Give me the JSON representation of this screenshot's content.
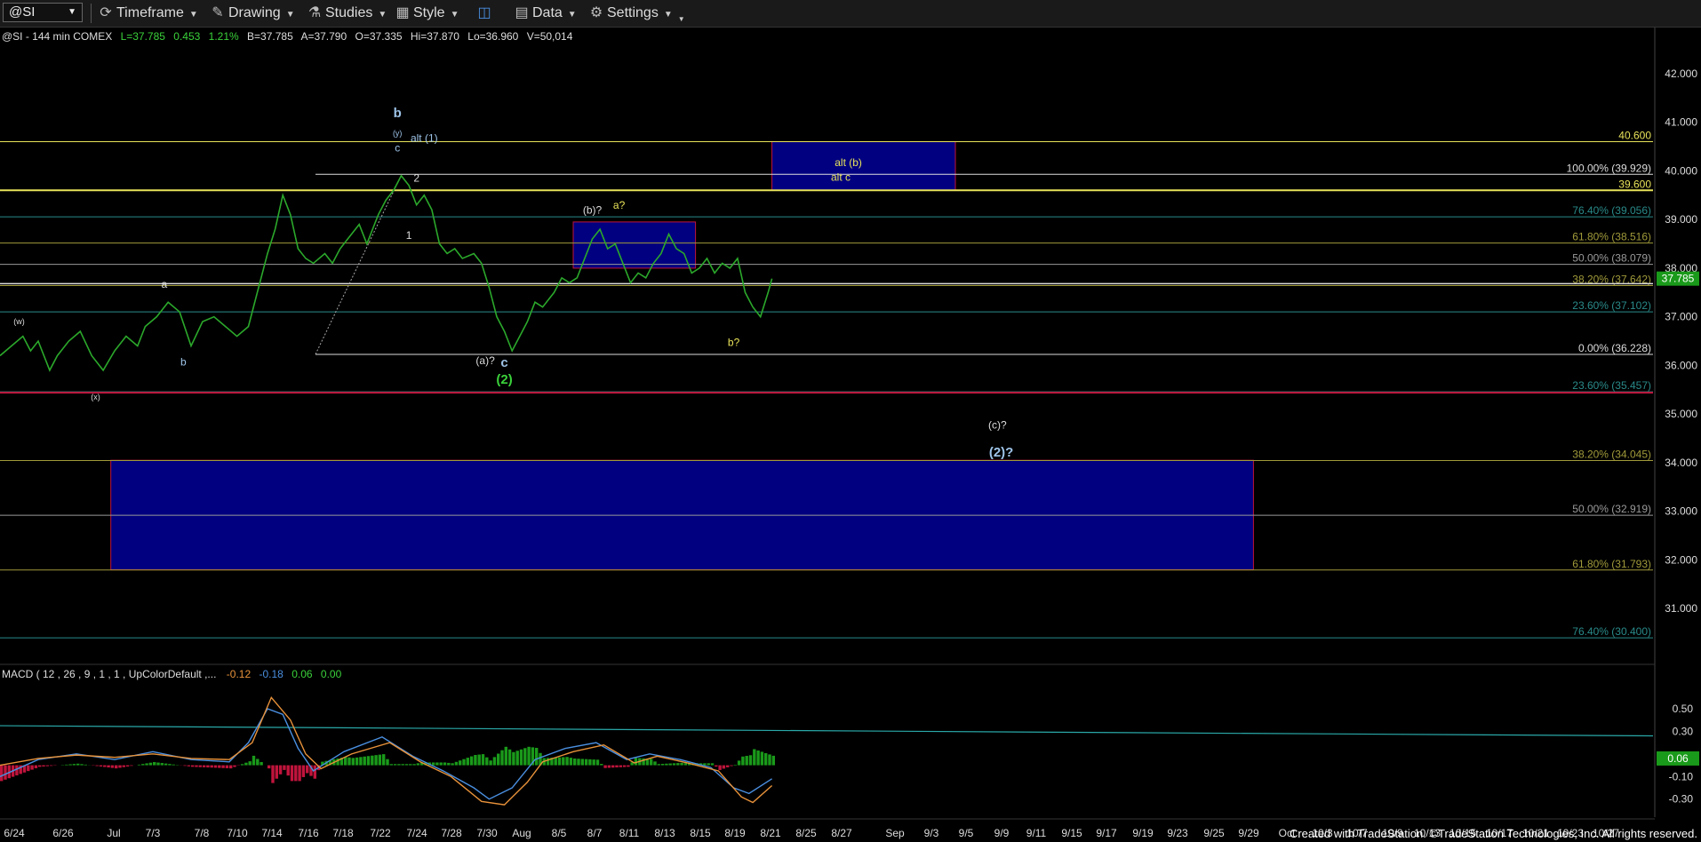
{
  "toolbar": {
    "symbol": "@SI",
    "timeframe": "Timeframe",
    "drawing": "Drawing",
    "studies": "Studies",
    "style": "Style",
    "data": "Data",
    "settings": "Settings"
  },
  "header": {
    "symbol_info": "@SI - 144 min  COMEX",
    "last": "L=37.785",
    "change": "0.453",
    "pct": "1.21%",
    "bid": "B=37.785",
    "ask": "A=37.790",
    "open": "O=37.335",
    "high": "Hi=37.870",
    "low": "Lo=36.960",
    "volume": "V=50,014"
  },
  "macd": {
    "label": "MACD ( 12 , 26 , 9 , 1 , 1 , UpColorDefault ,...",
    "v1": "-0.12",
    "v2": "-0.18",
    "v3": "0.06",
    "v4": "0.00",
    "current": "0.06"
  },
  "footer": "Created with TradeStation. ©TradeStation Technologies, Inc. All rights reserved.",
  "colors": {
    "price": "#2ba82b",
    "zone_fill": "#000080",
    "zone_border": "#c0143c",
    "yellow": "#e8e35a",
    "white": "#dddddd",
    "teal": "#2a8a8a"
  },
  "chart_data": [
    {
      "type": "line",
      "title": "",
      "ylim": [
        30.0,
        42.6
      ],
      "y_ticks": [
        "42.000",
        "41.000",
        "40.000",
        "39.000",
        "38.000",
        "37.000",
        "36.000",
        "35.000",
        "34.000",
        "33.000",
        "32.000",
        "31.000"
      ],
      "y_tick_values": [
        42,
        41,
        40,
        39,
        38,
        37,
        36,
        35,
        34,
        33,
        32,
        31
      ],
      "x_ticks": [
        "6/24",
        "6/26",
        "Jul",
        "7/3",
        "7/8",
        "7/10",
        "7/14",
        "7/16",
        "7/18",
        "7/22",
        "7/24",
        "7/28",
        "7/30",
        "Aug",
        "8/5",
        "8/7",
        "8/11",
        "8/13",
        "8/15",
        "8/19",
        "8/21",
        "8/25",
        "8/27",
        "Sep",
        "9/3",
        "9/5",
        "9/9",
        "9/11",
        "9/15",
        "9/17",
        "9/19",
        "9/23",
        "9/25",
        "9/29",
        "Oct",
        "10/3",
        "10/7",
        "10/9",
        "10/13",
        "10/15",
        "10/17",
        "10/21",
        "10/23",
        "10/27"
      ],
      "last_price": "37.785",
      "last_price_value": 37.785,
      "series": [
        {
          "values": [
            [
              0,
              36.2
            ],
            [
              3,
              36.4
            ],
            [
              6,
              36.6
            ],
            [
              8,
              36.3
            ],
            [
              10,
              36.5
            ],
            [
              13,
              35.9
            ],
            [
              15,
              36.2
            ],
            [
              18,
              36.5
            ],
            [
              21,
              36.7
            ],
            [
              24,
              36.2
            ],
            [
              27,
              35.9
            ],
            [
              30,
              36.3
            ],
            [
              33,
              36.6
            ],
            [
              36,
              36.4
            ],
            [
              38,
              36.8
            ],
            [
              41,
              37.0
            ],
            [
              44,
              37.3
            ],
            [
              47,
              37.1
            ],
            [
              50,
              36.4
            ],
            [
              53,
              36.9
            ],
            [
              56,
              37.0
            ],
            [
              59,
              36.8
            ],
            [
              62,
              36.6
            ],
            [
              65,
              36.8
            ],
            [
              67,
              37.4
            ],
            [
              70,
              38.3
            ],
            [
              72,
              38.8
            ],
            [
              74,
              39.5
            ],
            [
              76,
              39.1
            ],
            [
              78,
              38.4
            ],
            [
              80,
              38.2
            ],
            [
              82,
              38.1
            ],
            [
              85,
              38.3
            ],
            [
              87,
              38.1
            ],
            [
              89,
              38.4
            ],
            [
              91,
              38.6
            ],
            [
              94,
              38.9
            ],
            [
              96,
              38.5
            ],
            [
              99,
              39.1
            ],
            [
              101,
              39.4
            ],
            [
              103,
              39.6
            ],
            [
              105,
              39.9
            ],
            [
              107,
              39.7
            ],
            [
              109,
              39.3
            ],
            [
              111,
              39.5
            ],
            [
              113,
              39.2
            ],
            [
              115,
              38.5
            ],
            [
              117,
              38.3
            ],
            [
              119,
              38.4
            ],
            [
              121,
              38.2
            ],
            [
              124,
              38.3
            ],
            [
              126,
              38.1
            ],
            [
              128,
              37.6
            ],
            [
              130,
              37.0
            ],
            [
              132,
              36.7
            ],
            [
              134,
              36.3
            ],
            [
              136,
              36.6
            ],
            [
              138,
              36.9
            ],
            [
              140,
              37.3
            ],
            [
              142,
              37.2
            ],
            [
              145,
              37.5
            ],
            [
              147,
              37.8
            ],
            [
              149,
              37.7
            ],
            [
              151,
              37.8
            ],
            [
              153,
              38.2
            ],
            [
              155,
              38.6
            ],
            [
              157,
              38.8
            ],
            [
              159,
              38.4
            ],
            [
              161,
              38.5
            ],
            [
              163,
              38.1
            ],
            [
              165,
              37.7
            ],
            [
              167,
              37.9
            ],
            [
              169,
              37.8
            ],
            [
              171,
              38.1
            ],
            [
              173,
              38.3
            ],
            [
              175,
              38.7
            ],
            [
              177,
              38.4
            ],
            [
              179,
              38.3
            ],
            [
              181,
              37.9
            ],
            [
              183,
              38.0
            ],
            [
              185,
              38.2
            ],
            [
              187,
              37.9
            ],
            [
              189,
              38.1
            ],
            [
              191,
              38.0
            ],
            [
              193,
              38.2
            ],
            [
              195,
              37.5
            ],
            [
              197,
              37.2
            ],
            [
              199,
              37.0
            ],
            [
              201,
              37.5
            ],
            [
              202,
              37.785
            ]
          ]
        }
      ],
      "horizontal_levels": [
        {
          "label": "40.600",
          "value": 40.6,
          "color": "#e8e35a"
        },
        {
          "label": "100.00% (39.929)",
          "value": 39.929,
          "color": "#dddddd"
        },
        {
          "label": "39.600",
          "value": 39.6,
          "color": "#e8e35a"
        },
        {
          "label": "76.40% (39.056)",
          "value": 39.056,
          "color": "#2a8a8a"
        },
        {
          "label": "61.80% (38.516)",
          "value": 38.516,
          "color": "#a09a3a"
        },
        {
          "label": "50.00% (38.079)",
          "value": 38.079,
          "color": "#999999"
        },
        {
          "label": "38.20% (37.642)",
          "value": 37.642,
          "color": "#a09a3a"
        },
        {
          "label": "23.60% (37.102)",
          "value": 37.102,
          "color": "#2a8a8a"
        },
        {
          "label": "0.00% (36.228)",
          "value": 36.228,
          "color": "#dddddd"
        },
        {
          "label": "23.60% (35.457)",
          "value": 35.457,
          "color": "#2a8a8a"
        },
        {
          "label": "38.20% (34.045)",
          "value": 34.045,
          "color": "#a09a3a"
        },
        {
          "label": "50.00% (32.919)",
          "value": 32.919,
          "color": "#999999"
        },
        {
          "label": "61.80% (31.793)",
          "value": 31.793,
          "color": "#a09a3a"
        },
        {
          "label": "76.40% (30.400)",
          "value": 30.4,
          "color": "#2a8a8a"
        }
      ],
      "annotations": [
        {
          "text": "b",
          "x": 104,
          "y": 41.1,
          "color": "#9ec4e8",
          "bold": true
        },
        {
          "text": "(y)",
          "x": 104,
          "y": 40.72,
          "color": "#9ec4e8",
          "small": true
        },
        {
          "text": "c",
          "x": 104,
          "y": 40.4,
          "color": "#9ec4e8"
        },
        {
          "text": "alt (1)",
          "x": 111,
          "y": 40.6,
          "color": "#9ec4e8"
        },
        {
          "text": "2",
          "x": 109,
          "y": 39.78,
          "color": "#dddddd"
        },
        {
          "text": "1",
          "x": 107,
          "y": 38.6,
          "color": "#dddddd"
        },
        {
          "text": "(w)",
          "x": 5,
          "y": 36.85,
          "color": "#dddddd",
          "small": true
        },
        {
          "text": "a",
          "x": 43,
          "y": 37.6,
          "color": "#dddddd"
        },
        {
          "text": "b",
          "x": 48,
          "y": 36.0,
          "color": "#9ec4e8"
        },
        {
          "text": "(x)",
          "x": 25,
          "y": 35.3,
          "color": "#dddddd",
          "small": true
        },
        {
          "text": "(a)?",
          "x": 127,
          "y": 36.03,
          "color": "#dddddd"
        },
        {
          "text": "c",
          "x": 132,
          "y": 35.97,
          "color": "#9ec4e8",
          "bold": true
        },
        {
          "text": "(2)",
          "x": 132,
          "y": 35.62,
          "color": "#3ad13a",
          "bold": true
        },
        {
          "text": "(b)?",
          "x": 155,
          "y": 39.12,
          "color": "#dddddd"
        },
        {
          "text": "a?",
          "x": 162,
          "y": 39.22,
          "color": "#e8e35a"
        },
        {
          "text": "b?",
          "x": 192,
          "y": 36.4,
          "color": "#e8e35a"
        },
        {
          "text": "alt (b)",
          "x": 222,
          "y": 40.1,
          "color": "#e8e35a"
        },
        {
          "text": "alt c",
          "x": 220,
          "y": 39.8,
          "color": "#e8e35a"
        },
        {
          "text": "(c)?",
          "x": 261,
          "y": 34.7,
          "color": "#dddddd"
        },
        {
          "text": "(2)?",
          "x": 262,
          "y": 34.13,
          "color": "#9ec4e8",
          "bold": true
        }
      ],
      "zones": [
        {
          "x0": 202,
          "x1": 250,
          "y0": 39.6,
          "y1": 40.6
        },
        {
          "x0": 150,
          "x1": 182,
          "y0": 38.0,
          "y1": 38.95
        },
        {
          "x0": 29,
          "x1": 328,
          "y0": 31.8,
          "y1": 34.05
        }
      ]
    },
    {
      "type": "line",
      "title": "",
      "ylim": [
        -0.42,
        0.72
      ],
      "y_ticks": [
        "0.50",
        "0.30",
        "-0.10",
        "-0.30"
      ],
      "y_tick_values": [
        0.5,
        0.3,
        -0.1,
        -0.3
      ],
      "series": [
        {
          "values": [
            [
              0,
              -0.1
            ],
            [
              10,
              0.05
            ],
            [
              20,
              0.1
            ],
            [
              30,
              0.05
            ],
            [
              40,
              0.12
            ],
            [
              50,
              0.05
            ],
            [
              60,
              0.03
            ],
            [
              65,
              0.2
            ],
            [
              70,
              0.5
            ],
            [
              74,
              0.45
            ],
            [
              78,
              0.15
            ],
            [
              82,
              -0.05
            ],
            [
              90,
              0.12
            ],
            [
              100,
              0.25
            ],
            [
              108,
              0.08
            ],
            [
              116,
              -0.05
            ],
            [
              124,
              -0.2
            ],
            [
              128,
              -0.3
            ],
            [
              134,
              -0.2
            ],
            [
              140,
              0.05
            ],
            [
              148,
              0.15
            ],
            [
              156,
              0.2
            ],
            [
              164,
              0.05
            ],
            [
              170,
              0.1
            ],
            [
              178,
              0.05
            ],
            [
              186,
              -0.02
            ],
            [
              192,
              -0.2
            ],
            [
              196,
              -0.25
            ],
            [
              202,
              -0.12
            ]
          ]
        },
        {
          "values": [
            [
              0,
              0.0
            ],
            [
              10,
              0.06
            ],
            [
              20,
              0.09
            ],
            [
              30,
              0.07
            ],
            [
              40,
              0.1
            ],
            [
              50,
              0.06
            ],
            [
              60,
              0.05
            ],
            [
              66,
              0.2
            ],
            [
              71,
              0.6
            ],
            [
              76,
              0.4
            ],
            [
              80,
              0.1
            ],
            [
              84,
              -0.03
            ],
            [
              92,
              0.1
            ],
            [
              102,
              0.2
            ],
            [
              110,
              0.03
            ],
            [
              118,
              -0.1
            ],
            [
              126,
              -0.32
            ],
            [
              132,
              -0.35
            ],
            [
              138,
              -0.15
            ],
            [
              142,
              0.03
            ],
            [
              150,
              0.12
            ],
            [
              158,
              0.18
            ],
            [
              166,
              0.02
            ],
            [
              172,
              0.08
            ],
            [
              180,
              0.02
            ],
            [
              188,
              -0.05
            ],
            [
              194,
              -0.28
            ],
            [
              197,
              -0.33
            ],
            [
              202,
              -0.18
            ]
          ]
        },
        {
          "values": [
            [
              0,
              0.0
            ],
            [
              202,
              0.0
            ]
          ]
        }
      ],
      "trendline": [
        [
          0,
          0.35
        ],
        [
          372,
          0.26
        ]
      ]
    }
  ]
}
